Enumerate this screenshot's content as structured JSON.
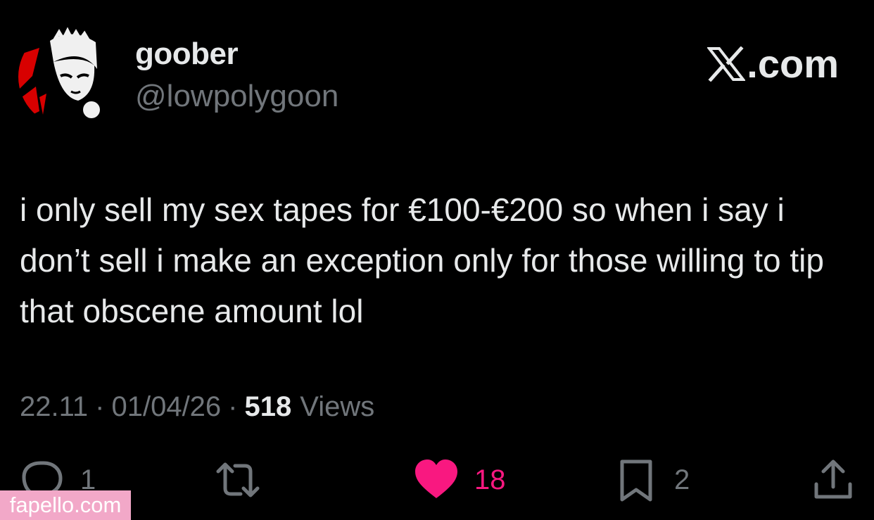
{
  "author": {
    "display_name": "goober",
    "handle": "@lowpolygoon"
  },
  "brand": {
    "label": ".com"
  },
  "tweet": {
    "text": "i only sell my sex tapes for €100-€200 so when i say i don’t sell i make an exception only for those willing to tip that obscene amount lol"
  },
  "meta": {
    "time": "22.11",
    "separator": "·",
    "date": "01/04/26",
    "views_count": "518",
    "views_label": "Views"
  },
  "actions": {
    "reply": {
      "icon": "reply-icon",
      "count": "1"
    },
    "repost": {
      "icon": "repost-icon"
    },
    "like": {
      "icon": "heart-icon",
      "count": "18",
      "color": "#f91880"
    },
    "bookmark": {
      "icon": "bookmark-icon",
      "count": "2"
    },
    "share": {
      "icon": "share-icon"
    }
  },
  "watermark": {
    "text": "fapello.com"
  }
}
